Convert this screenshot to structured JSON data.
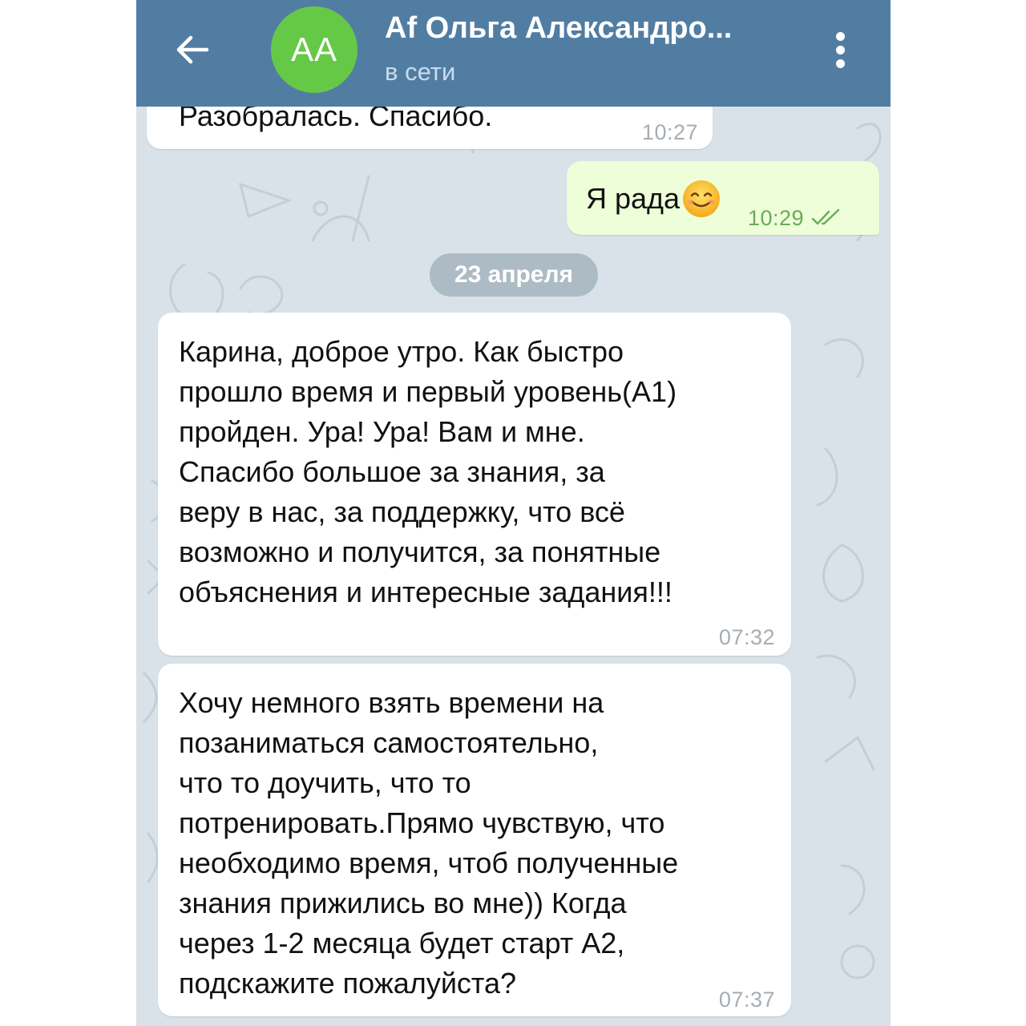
{
  "header": {
    "back_icon": "arrow-left-icon",
    "avatar_initials": "AA",
    "avatar_color": "#65c947",
    "title": "Af Ольга Александро...",
    "status": "в сети",
    "menu_icon": "more-vert-icon",
    "header_color": "#527da3"
  },
  "messages": [
    {
      "direction": "incoming",
      "text": "Разобралась. Спасибо.",
      "time": "10:27"
    },
    {
      "direction": "outgoing",
      "text": "Я рада",
      "emoji": "smiling-face-icon",
      "time": "10:29",
      "status_icon": "double-check-icon"
    },
    {
      "direction": "incoming",
      "lines": [
        "Карина, доброе утро. Как быстро",
        "прошло время и первый уровень(А1)",
        "пройден. Ура! Ура! Вам и мне.",
        "Спасибо большое за знания, за",
        "веру в нас, за поддержку, что всё",
        "возможно и получится, за понятные",
        "объяснения и интересные задания!!!"
      ],
      "time": "07:32"
    },
    {
      "direction": "incoming",
      "lines": [
        "Хочу немного взять времени на",
        "позаниматься самостоятельно,",
        "что то доучить, что то",
        "потренировать.Прямо чувствую, что",
        "необходимо время, чтоб полученные",
        "знания прижились во мне)) Когда",
        "через 1-2 месяца будет старт А2,",
        "подскажите пожалуйста?"
      ],
      "time": "07:37"
    }
  ],
  "date_separator": "23 апреля",
  "colors": {
    "background": "#d9e2e8",
    "incoming_bubble": "#ffffff",
    "outgoing_bubble": "#eefed9",
    "outgoing_time": "#68ab5a"
  }
}
